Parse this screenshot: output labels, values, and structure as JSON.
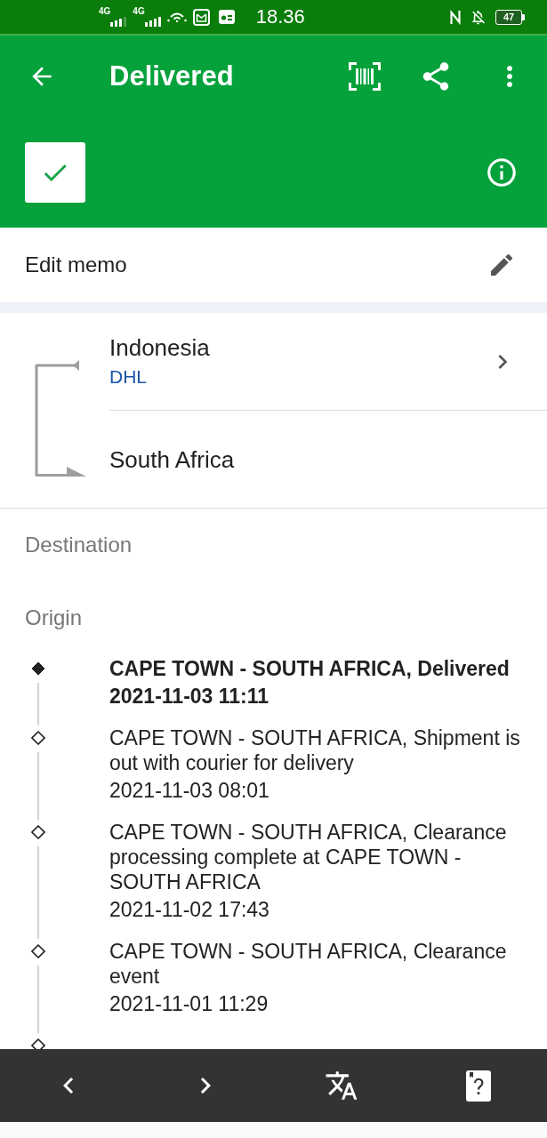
{
  "status_bar": {
    "signals": [
      {
        "label": "4G"
      },
      {
        "label": "4G"
      }
    ],
    "time": "18.36",
    "battery": "47"
  },
  "app_bar": {
    "title": "Delivered"
  },
  "status_badge": {
    "checked": true
  },
  "memo": {
    "label": "Edit memo"
  },
  "route": {
    "origin": "Indonesia",
    "carrier": "DHL",
    "destination": "South Africa"
  },
  "section_labels": [
    "Destination",
    "Origin"
  ],
  "events": [
    {
      "description": "CAPE TOWN - SOUTH AFRICA, Delivered",
      "time": "2021-11-03 11:11",
      "latest": true
    },
    {
      "description": "CAPE TOWN - SOUTH AFRICA, Shipment is out with courier for delivery",
      "time": "2021-11-03 08:01",
      "latest": false
    },
    {
      "description": "CAPE TOWN - SOUTH AFRICA, Clearance processing complete at CAPE TOWN - SOUTH AFRICA",
      "time": "2021-11-02 17:43",
      "latest": false
    },
    {
      "description": "CAPE TOWN - SOUTH AFRICA, Clearance event",
      "time": "2021-11-01 11:29",
      "latest": false
    },
    {
      "latest": false
    }
  ]
}
